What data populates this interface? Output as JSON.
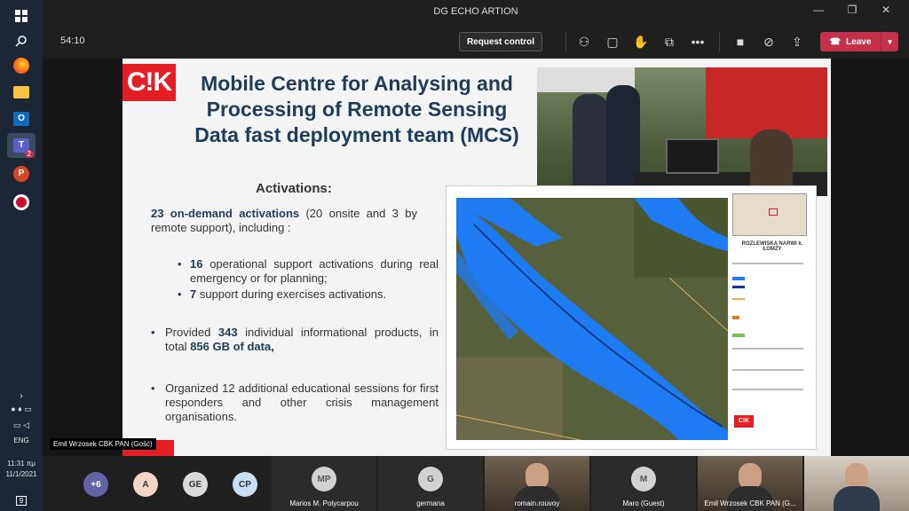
{
  "window": {
    "title": "DG ECHO ARTION"
  },
  "meeting": {
    "timer": "54:10",
    "request_control": "Request control",
    "leave": "Leave"
  },
  "taskbar": {
    "teams_badge": "2",
    "lang": "ENG",
    "time": "11:31 πμ",
    "date": "11/1/2021",
    "notif_count": "9"
  },
  "slide": {
    "logo": "C!K",
    "title": "Mobile Centre for Analysing and Processing of Remote Sensing Data fast deployment team (MCS)",
    "activations_heading": "Activations:",
    "p1_bold": "23 on-demand activations",
    "p1_rest": " (20 onsite and 3 by remote support), including :",
    "b1_bold": "16",
    "b1_rest": " operational support activations during real emergency or for planning;",
    "b2_bold": "7",
    "b2_rest": " support during exercises activations.",
    "b3_pre": "Provided ",
    "b3_bold1": "343",
    "b3_mid": " individual informational products, in total ",
    "b3_bold2": "856 GB of data,",
    "b4": "Organized 12 additional educational sessions for first responders and other crisis management organisations.",
    "map_title": "ROZLEWISKA NARWI k. ŁOMŻY",
    "map_logo": "C!K"
  },
  "presenter_label": "Emil Wrzosek CBK PAN (Gość)",
  "participants": [
    {
      "initials": "+6",
      "color": "#6264a7"
    },
    {
      "initials": "A",
      "color": "#f3d6c8"
    },
    {
      "initials": "GE",
      "color": "#d9d9d9"
    },
    {
      "initials": "CP",
      "color": "#c7dff0"
    }
  ],
  "tiles": [
    {
      "initials": "MP",
      "name": "Marios M. Polycarpou"
    },
    {
      "initials": "G",
      "name": "germana"
    },
    {
      "initials": "",
      "name": "romain.rouvoy"
    },
    {
      "initials": "M",
      "name": "Maro (Guest)"
    },
    {
      "initials": "",
      "name": "Emil Wrzosek CBK PAN (G..."
    },
    {
      "initials": "",
      "name": ""
    }
  ]
}
